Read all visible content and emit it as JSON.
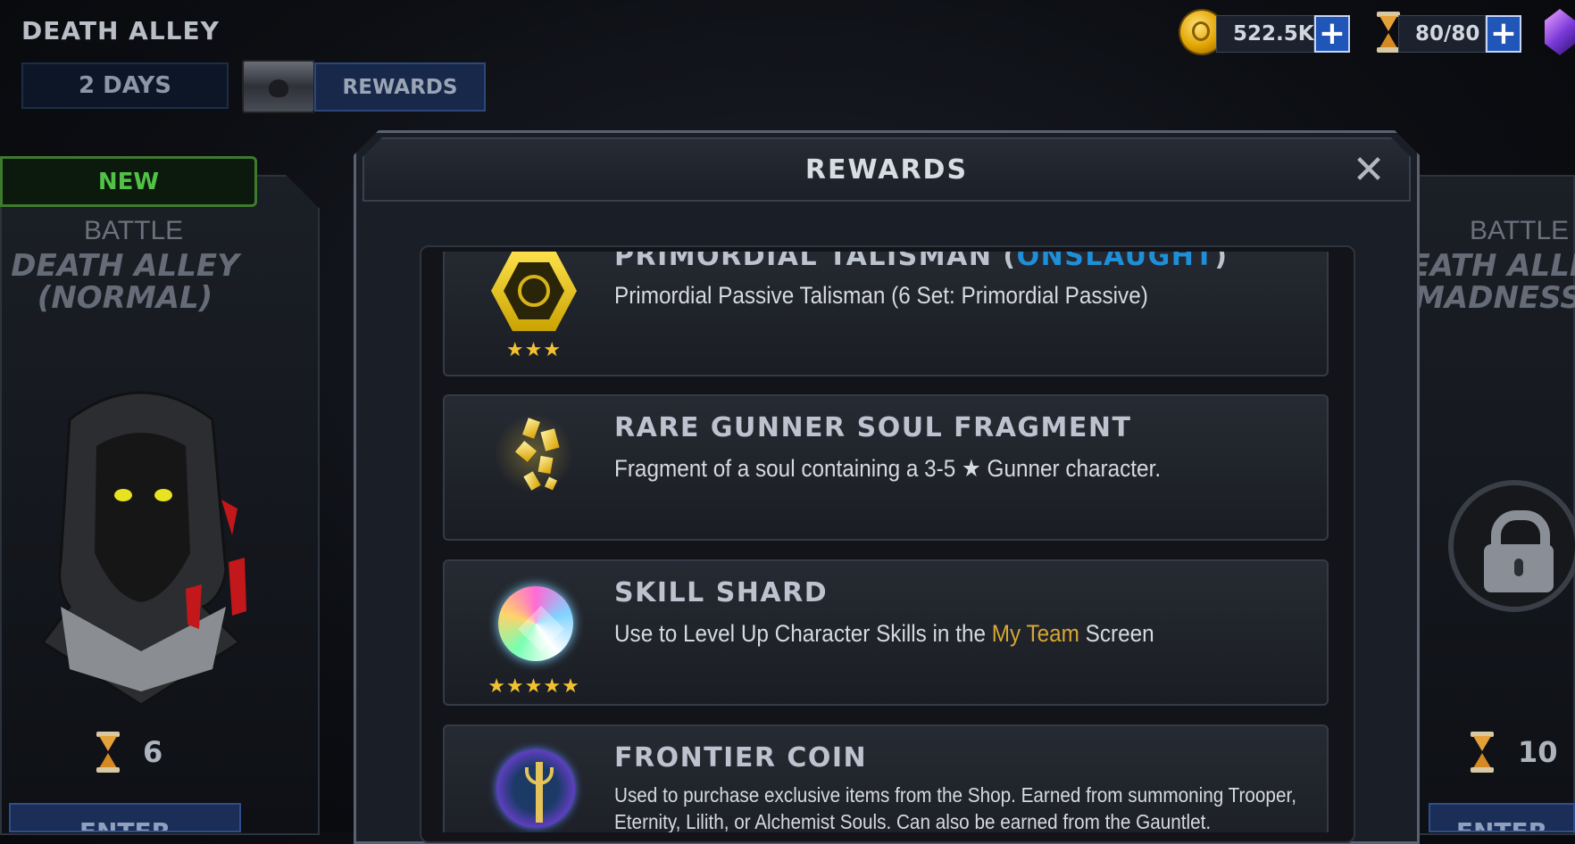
{
  "event": {
    "title": "DEATH ALLEY",
    "duration": "2 DAYS",
    "rewards_button": "REWARDS"
  },
  "currencies": {
    "gold": "522.5K",
    "energy": "80/80"
  },
  "left_battle": {
    "badge": "NEW",
    "label": "BATTLE",
    "name_line1": "DEATH ALLEY",
    "name_line2": "(NORMAL)",
    "cost": "6",
    "enter": "ENTER"
  },
  "right_battle": {
    "label": "BATTLE",
    "name_line1": "DEATH ALLEY",
    "name_line2": "(MADNESS)",
    "cost": "10",
    "enter": "ENTER"
  },
  "modal": {
    "title": "REWARDS",
    "close_icon": "close-icon",
    "items": [
      {
        "icon": "talisman-icon",
        "name_prefix": "PRIMORDIAL TALISMAN (",
        "name_highlight": "ONSLAUGHT",
        "name_suffix": ")",
        "description": "Primordial Passive Talisman (6 Set: Primordial Passive)",
        "stars": "★★★"
      },
      {
        "icon": "soul-fragment-icon",
        "name": "RARE GUNNER SOUL FRAGMENT",
        "description": "Fragment of a soul containing a 3-5 ★  Gunner character.",
        "stars": ""
      },
      {
        "icon": "skill-shard-icon",
        "name": "SKILL SHARD",
        "desc_prefix": "Use to Level Up Character Skills in the ",
        "desc_highlight": "My Team",
        "desc_suffix": " Screen",
        "stars": "★★★★★"
      },
      {
        "icon": "frontier-coin-icon",
        "name": "FRONTIER COIN",
        "desc_line1": "Used to purchase exclusive items from the Shop. Earned from summoning Trooper,",
        "desc_line2": "Eternity, Lilith, or Alchemist Souls. Can also be earned from the Gauntlet."
      }
    ]
  },
  "colors": {
    "accent_blue": "#1e8fd8",
    "highlight_gold": "#d5a735",
    "new_green": "#52c246",
    "star_gold": "#f3c130"
  }
}
